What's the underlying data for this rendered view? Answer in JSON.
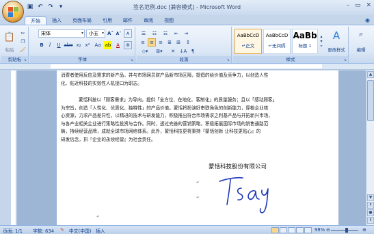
{
  "title": "签名范例.doc [兼容模式] - Microsoft Word",
  "tabs": [
    "开始",
    "插入",
    "页面布局",
    "引用",
    "邮件",
    "审阅",
    "视图"
  ],
  "ribbon": {
    "clipboard": {
      "paste": "粘贴",
      "label": "剪贴板"
    },
    "font": {
      "name": "宋体",
      "size": "小五",
      "label": "字体"
    },
    "paragraph": {
      "label": "段落"
    },
    "styles": {
      "label": "样式",
      "items": [
        {
          "preview": "AaBbCcD",
          "name": "↵正文"
        },
        {
          "preview": "AaBbCcD",
          "name": "↵无间隔"
        },
        {
          "preview": "AaBb",
          "name": "标题 1"
        }
      ],
      "change_styles": "更改样式"
    },
    "editing": {
      "label": "编辑"
    }
  },
  "document": {
    "line1": "消费者使用反应及需求的新产品，并与市场网员财产品新市场区隔，提倡的给价值及竞争力，以创造人性",
    "line2": "化、贴近科技的实效性人机接口为职志。",
    "para2_lines": [
      "蒙恬科技以「顾客需求」为导向，提供「全方位、在地化、客制化」的质量服务；且以「感动顾客」",
      "为宗旨，创造「人性化、优质化、独特性」的产品价值。蒙恬将扮演好串联角色的创新能力，厚植企业核",
      "心资源，力求产品差异性，以精进的技术与研发能力，积极推出符合市场需求之利基产品与开拓新兴市场，",
      "与各产业相关企业进行策略性投资与合作。同时，透过完善的营销策略，积极拓展国际市场的销售通路范",
      "畴，持续经营品牌，成就全球市场网络体系。此外，蒙恬科技更将秉持『蒙恬创新 让科技更贴心』的",
      "研发信念，拱『企业的永续经营』为社会责任。"
    ],
    "company": "蒙恬科技股份有限公司",
    "signature": "Tsay",
    "para_mark": "↵"
  },
  "status": {
    "page": "页面: 1/1",
    "words": "字数: 634",
    "language": "中文(中国)",
    "mode": "插入",
    "zoom": "98%"
  },
  "colors": {
    "signature_ink": "#1a35b8",
    "ribbon_accent": "#15428b"
  }
}
